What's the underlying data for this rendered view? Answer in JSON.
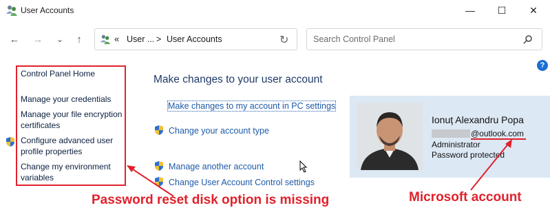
{
  "window": {
    "title": "User Accounts",
    "controls": {
      "minimize": "—",
      "maximize": "☐",
      "close": "✕"
    }
  },
  "nav": {
    "back_glyph": "←",
    "forward_glyph": "→",
    "recent_glyph": "⌄",
    "up_glyph": "↑",
    "breadcrumb": {
      "chevrons": "«",
      "part1": "User ...",
      "sep": ">",
      "part2": "User Accounts"
    },
    "refresh_glyph": "↻",
    "search_placeholder": "Search Control Panel"
  },
  "left_pane": {
    "home": "Control Panel Home",
    "credentials": "Manage your credentials",
    "encryption": "Manage your file encryption certificates",
    "profile": "Configure advanced user profile properties",
    "environment": "Change my environment variables"
  },
  "main": {
    "heading": "Make changes to your user account",
    "pc_settings": "Make changes to my account in PC settings",
    "account_type": "Change your account type",
    "another": "Manage another account",
    "uac": "Change User Account Control settings"
  },
  "account": {
    "name": "Ionuț Alexandru Popa",
    "email_visible": "@outlook.com",
    "role": "Administrator",
    "status": "Password protected"
  },
  "annotations": {
    "left": "Password reset disk option is missing",
    "right": "Microsoft account",
    "color": "#e0212b"
  },
  "help_glyph": "?"
}
